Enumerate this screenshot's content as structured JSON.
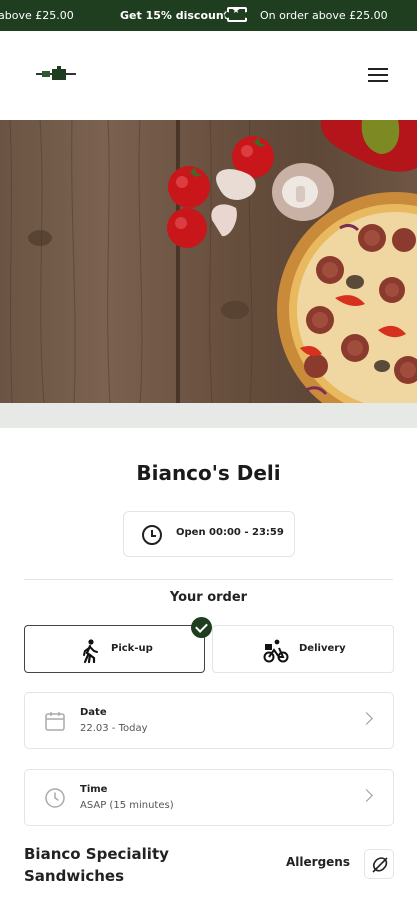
{
  "promo": {
    "segment_left": "above £25.00",
    "segment_bold": "Get 15% discount",
    "segment_right": "On order above £25.00",
    "ticket_icon": "discount-ticket-icon"
  },
  "header": {
    "logo_icon": "deli-logo-icon",
    "menu_icon": "hamburger-menu-icon"
  },
  "store": {
    "name": "Bianco's Deli",
    "hours": "Open 00:00 - 23:59"
  },
  "order": {
    "heading": "Your order",
    "pickup_label": "Pick-up",
    "delivery_label": "Delivery",
    "selected": "Pick-up",
    "date_title": "Date",
    "date_value": "22.03 - Today",
    "time_title": "Time",
    "time_value": "ASAP (15 minutes)"
  },
  "section": {
    "title": "Bianco Speciality Sandwiches",
    "allergens_label": "Allergens"
  },
  "colors": {
    "brand": "#1f3d1f",
    "border": "#e4e4e4"
  }
}
